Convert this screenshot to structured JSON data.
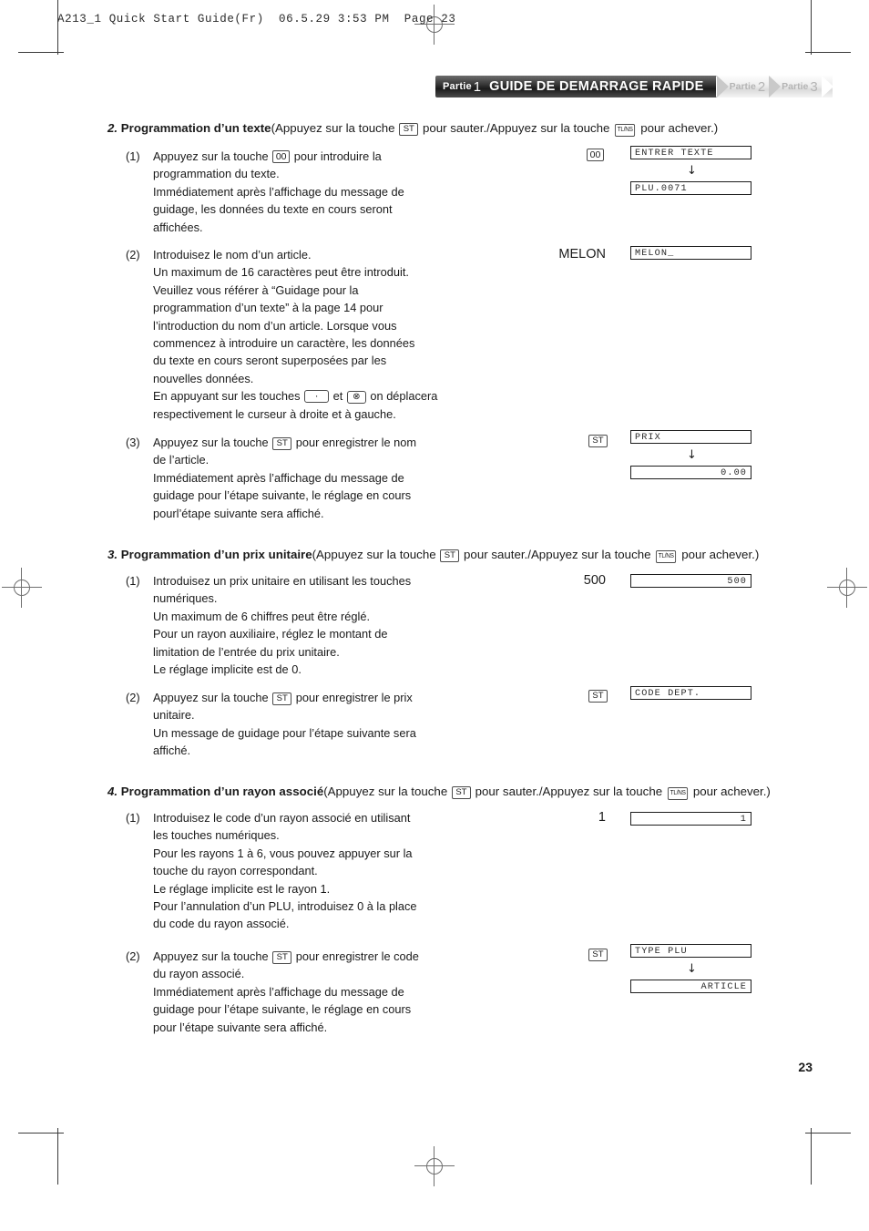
{
  "film_header": "A213_1 Quick Start Guide(Fr)  06.5.29 3:53 PM  Page 23",
  "banner": {
    "active_partie_word": "Partie",
    "active_partie_num": "1",
    "title": "GUIDE DE DEMARRAGE RAPIDE",
    "tabs": [
      {
        "word": "Partie",
        "num": "2"
      },
      {
        "word": "Partie",
        "num": "3"
      }
    ],
    "active_color": "#1b1b1b",
    "inactive_color": "#b4b4b4"
  },
  "page_number": "23",
  "keys": {
    "st": "ST",
    "tlns": "TL/NS",
    "zero_zero": "00",
    "dot": "·",
    "multiply": "⊗"
  },
  "sections": [
    {
      "number": "2.",
      "title": "Programmation d’un texte",
      "paren_prefix": "(Appuyez sur la touche ",
      "paren_mid": " pour sauter./Appuyez sur la touche ",
      "paren_suffix": " pour achever.)",
      "steps": [
        {
          "label": "(1)",
          "lines_a": [
            "Appuyez sur la touche "
          ],
          "lines_b": [
            " pour introduire la",
            "programmation du texte.",
            "Immédiatement après l’affichage du message de",
            "guidage, les données du texte en cours seront",
            "affichées."
          ],
          "entry_key": "00",
          "displays": [
            "ENTRER TEXTE",
            "PLU.0071"
          ],
          "display_align": [
            "left",
            "left"
          ],
          "has_arrow": true
        },
        {
          "label": "(2)",
          "lines": [
            "Introduisez le nom d’un article.",
            "Un maximum de 16 caractères peut être introduit.",
            "Veuillez vous référer à “Guidage pour la",
            "programmation d’un texte” à la page 14 pour",
            "l’introduction du nom d’un article. Lorsque vous",
            "commencez à introduire un caractère, les données",
            "du texte en cours seront superposées par les",
            "nouvelles données."
          ],
          "key_line_prefix": "En appuyant sur les touches ",
          "key_line_mid": " et ",
          "key_line_suffix": " on déplacera",
          "key_line_last": "respectivement le curseur à droite et à gauche.",
          "entry_value": "MELON",
          "displays": [
            "MELON_"
          ],
          "display_align": [
            "left"
          ],
          "has_arrow": false
        },
        {
          "label": "(3)",
          "lines_a": [
            "Appuyez sur la touche "
          ],
          "lines_b": [
            " pour enregistrer le nom",
            "de l’article.",
            "Immédiatement après l’affichage du message de",
            "guidage pour l’étape suivante, le réglage en cours",
            "pourl’étape suivante sera affiché."
          ],
          "entry_key": "ST",
          "displays": [
            "PRIX",
            "0.00"
          ],
          "display_align": [
            "left",
            "right"
          ],
          "has_arrow": true
        }
      ]
    },
    {
      "number": "3.",
      "title": "Programmation d’un prix unitaire",
      "paren_prefix": "(Appuyez sur la touche ",
      "paren_mid": " pour sauter./Appuyez sur la touche ",
      "paren_suffix": " pour achever.)",
      "steps": [
        {
          "label": "(1)",
          "lines": [
            "Introduisez un prix unitaire en utilisant les touches",
            "numériques.",
            "Un maximum de 6 chiffres peut être réglé.",
            "Pour un rayon auxiliaire, réglez le montant de",
            "limitation de l’entrée du prix unitaire.",
            "Le réglage implicite est de 0."
          ],
          "entry_value": "500",
          "displays": [
            "500"
          ],
          "display_align": [
            "right"
          ],
          "has_arrow": false
        },
        {
          "label": "(2)",
          "lines_a": [
            "Appuyez sur la touche "
          ],
          "lines_b": [
            " pour enregistrer le prix",
            "unitaire.",
            "Un message de guidage pour l’étape suivante sera",
            "affiché."
          ],
          "entry_key": "ST",
          "displays": [
            "CODE DEPT."
          ],
          "display_align": [
            "left"
          ],
          "has_arrow": false
        }
      ]
    },
    {
      "number": "4.",
      "title": "Programmation d’un rayon associé",
      "paren_prefix": "(Appuyez sur la touche ",
      "paren_mid": " pour sauter./Appuyez sur la touche ",
      "paren_suffix": " pour achever.)",
      "steps": [
        {
          "label": "(1)",
          "lines": [
            "Introduisez le code d’un rayon associé en utilisant",
            "les touches numériques.",
            "Pour les rayons 1 à 6, vous pouvez appuyer sur la",
            "touche du rayon correspondant.",
            "Le réglage implicite est le rayon 1.",
            "Pour l’annulation d’un PLU, introduisez 0 à la place",
            "du code du rayon associé."
          ],
          "entry_value": "1",
          "displays": [
            "1"
          ],
          "display_align": [
            "right"
          ],
          "has_arrow": false
        },
        {
          "label": "(2)",
          "lines_a": [
            "Appuyez sur la touche "
          ],
          "lines_b": [
            " pour enregistrer le code",
            "du rayon associé.",
            "Immédiatement après l’affichage du message de",
            "guidage pour l’étape suivante, le réglage en cours",
            "pour l’étape suivante sera affiché."
          ],
          "entry_key": "ST",
          "displays": [
            "TYPE PLU",
            "ARTICLE"
          ],
          "display_align": [
            "left",
            "right"
          ],
          "has_arrow": true
        }
      ]
    }
  ]
}
